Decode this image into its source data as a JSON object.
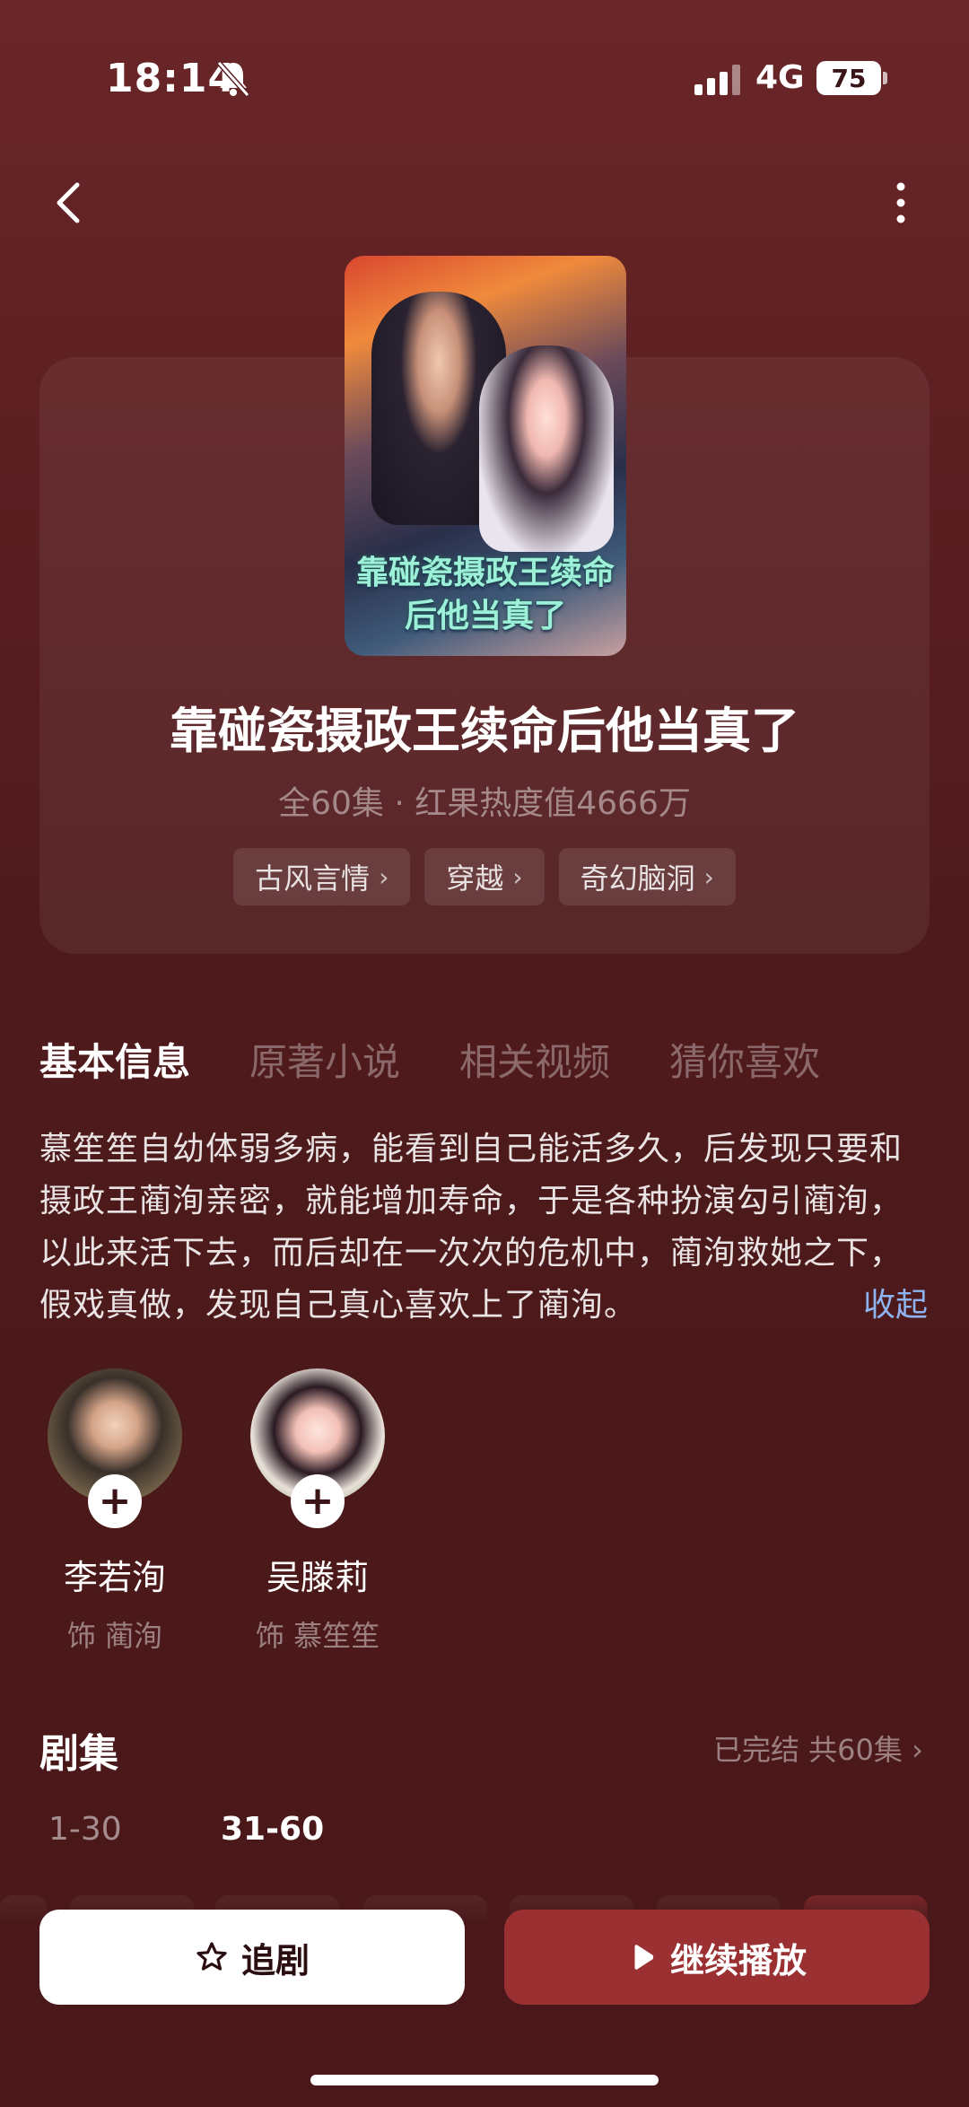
{
  "status_bar": {
    "time": "18:14",
    "network": "4G",
    "battery": "75",
    "icons": [
      "bell-muted-icon",
      "signal-icon",
      "battery-icon"
    ]
  },
  "nav": {
    "back_icon": "chevron-left-icon",
    "more_icon": "more-vertical-icon"
  },
  "drama": {
    "poster_title": "靠碰瓷摄政王续命后他当真了",
    "title": "靠碰瓷摄政王续命后他当真了",
    "meta": "全60集 · 红果热度值4666万",
    "tags": [
      {
        "label": "古风言情"
      },
      {
        "label": "穿越"
      },
      {
        "label": "奇幻脑洞"
      }
    ]
  },
  "tabs": [
    {
      "label": "基本信息",
      "active": true
    },
    {
      "label": "原著小说",
      "active": false
    },
    {
      "label": "相关视频",
      "active": false
    },
    {
      "label": "猜你喜欢",
      "active": false
    }
  ],
  "synopsis": {
    "text": "慕笙笙自幼体弱多病，能看到自己能活多久，后发现只要和摄政王蔺洵亲密，就能增加寿命，于是各种扮演勾引蔺洵，以此来活下去，而后却在一次次的危机中，蔺洵救她之下，假戏真做，发现自己真心喜欢上了蔺洵。",
    "collapse_label": "收起"
  },
  "cast": [
    {
      "name": "李若洵",
      "role": "饰 蔺洵",
      "add": "+"
    },
    {
      "name": "吴滕莉",
      "role": "饰 慕笙笙",
      "add": "+"
    }
  ],
  "episodes": {
    "heading": "剧集",
    "status": "已完结 共60集",
    "ranges": [
      "1-30",
      "31-60"
    ],
    "active_range": "31-60"
  },
  "actions": {
    "follow_label": "追剧",
    "play_label": "继续播放",
    "colors": {
      "play": "#9b3032",
      "follow": "#ffffff",
      "link": "#8db4f0"
    }
  }
}
